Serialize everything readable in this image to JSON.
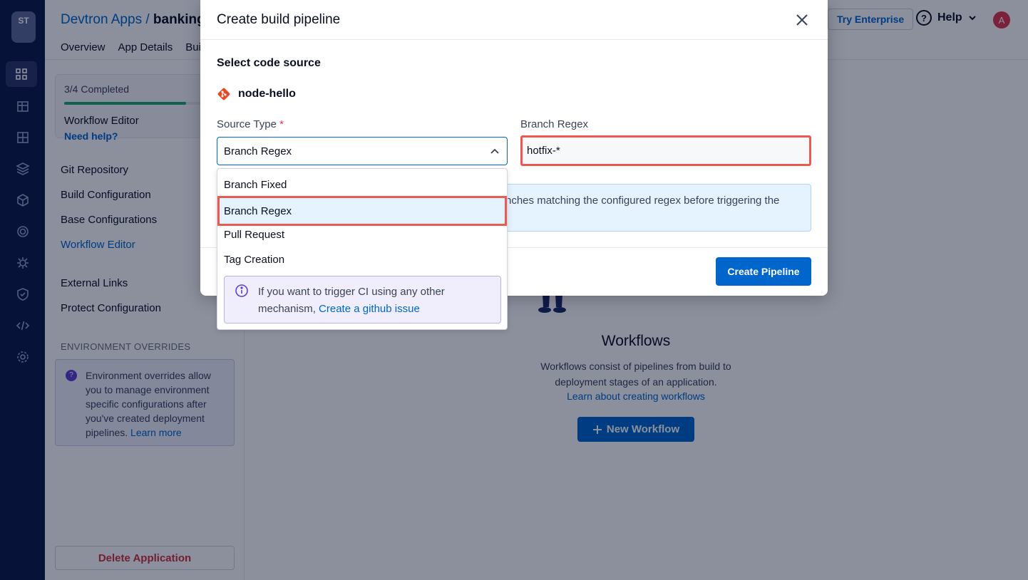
{
  "app": {
    "logo_text": "ST",
    "breadcrumb": {
      "parent": "Devtron Apps /",
      "current": "banking"
    },
    "tabs": [
      "Overview",
      "App Details",
      "Bui"
    ],
    "try_enterprise": "Try Enterprise",
    "help": "Help",
    "avatar_letter": "A",
    "progress": {
      "label": "3/4 Completed",
      "fraction": 0.75,
      "current_step": "Workflow Editor",
      "need_help": "Need help?"
    },
    "nav": [
      "Git Repository",
      "Build Configuration",
      "Base Configurations",
      "Workflow Editor"
    ],
    "nav_secondary": [
      "External Links",
      "Protect Configuration"
    ],
    "env_overrides": {
      "heading": "ENVIRONMENT OVERRIDES",
      "text": "Environment overrides allow you to manage environment specific configurations after you've created deployment pipelines.",
      "learn_more": "Learn more"
    },
    "delete_button": "Delete Application",
    "workflows": {
      "title": "Workflows",
      "description": "Workflows consist of pipelines from build to deployment stages of an application.",
      "learn_link": "Learn about creating workflows",
      "new_button": "New Workflow"
    }
  },
  "modal": {
    "title": "Create build pipeline",
    "section_title": "Select code source",
    "repo_name": "node-hello",
    "source_type_label": "Source Type",
    "required_mark": "*",
    "source_type_value": "Branch Regex",
    "branch_regex_label": "Branch Regex",
    "branch_regex_value": "hotfix-*",
    "info_text": "nches matching the configured regex before triggering the",
    "create_button": "Create Pipeline",
    "options": [
      "Branch Fixed",
      "Branch Regex",
      "Pull Request",
      "Tag Creation"
    ],
    "selected_option": "Branch Regex",
    "menu_note": {
      "text": "If you want to trigger CI using any other mechanism,",
      "link": "Create a github issue"
    }
  },
  "colors": {
    "primary": "#0066cc",
    "highlight": "#ea5a50",
    "rail": "#0e1a4a",
    "danger": "#d0323d"
  }
}
